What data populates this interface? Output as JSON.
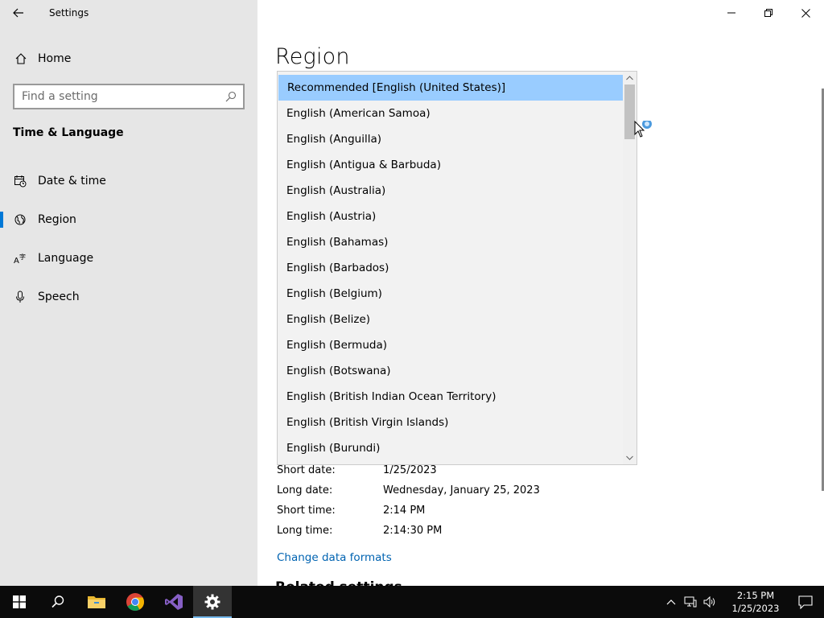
{
  "window": {
    "app_title": "Settings"
  },
  "sidebar": {
    "home_label": "Home",
    "search_placeholder": "Find a setting",
    "section_title": "Time & Language",
    "items": [
      {
        "label": "Date & time",
        "icon": "calendar-clock-icon"
      },
      {
        "label": "Region",
        "icon": "globe-icon",
        "selected": true
      },
      {
        "label": "Language",
        "icon": "language-icon"
      },
      {
        "label": "Speech",
        "icon": "microphone-icon"
      }
    ]
  },
  "main": {
    "page_title": "Region",
    "region_dropdown": {
      "options": [
        "Recommended [English (United States)]",
        "English (American Samoa)",
        "English (Anguilla)",
        "English (Antigua & Barbuda)",
        "English (Australia)",
        "English (Austria)",
        "English (Bahamas)",
        "English (Barbados)",
        "English (Belgium)",
        "English (Belize)",
        "English (Bermuda)",
        "English (Botswana)",
        "English (British Indian Ocean Territory)",
        "English (British Virgin Islands)",
        "English (Burundi)"
      ],
      "selected_index": 0
    },
    "formats": [
      {
        "label": "Short date:",
        "value": "1/25/2023"
      },
      {
        "label": "Long date:",
        "value": "Wednesday, January 25, 2023"
      },
      {
        "label": "Short time:",
        "value": "2:14 PM"
      },
      {
        "label": "Long time:",
        "value": "2:14:30 PM"
      }
    ],
    "change_formats_link": "Change data formats",
    "related_settings_heading": "Related settings"
  },
  "taskbar": {
    "apps": [
      "start-icon",
      "search-icon",
      "file-explorer-icon",
      "chrome-icon",
      "visual-studio-icon",
      "settings-gear-icon"
    ],
    "clock_time": "2:15 PM",
    "clock_date": "1/25/2023"
  },
  "colors": {
    "accent": "#0078d7",
    "selection": "#99ccff",
    "link": "#0063b1",
    "sidebar_bg": "#e6e6e6",
    "taskbar_bg": "#0b0b0b"
  }
}
